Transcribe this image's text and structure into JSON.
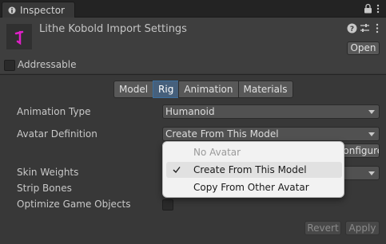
{
  "window": {
    "tab_title": "Inspector"
  },
  "header": {
    "title": "Lithe Kobold Import Settings",
    "open_label": "Open",
    "asset_icon_color": "#e020c8"
  },
  "addressable": {
    "label": "Addressable",
    "checked": false
  },
  "tabs": [
    "Model",
    "Rig",
    "Animation",
    "Materials"
  ],
  "active_tab": "Rig",
  "properties": {
    "animation_type_label": "Animation Type",
    "animation_type_value": "Humanoid",
    "avatar_definition_label": "Avatar Definition",
    "avatar_definition_value": "Create From This Model",
    "configure_label": "Configure...",
    "skin_weights_label": "Skin Weights",
    "strip_bones_label": "Strip Bones",
    "optimize_label": "Optimize Game Objects"
  },
  "footer": {
    "revert_label": "Revert",
    "apply_label": "Apply"
  },
  "popup": {
    "items": [
      {
        "label": "No Avatar",
        "enabled": false,
        "selected": false
      },
      {
        "label": "Create From This Model",
        "enabled": true,
        "selected": true
      },
      {
        "label": "Copy From Other Avatar",
        "enabled": true,
        "selected": false
      }
    ]
  },
  "colors": {
    "accent": "#46607c",
    "background": "#383838"
  }
}
